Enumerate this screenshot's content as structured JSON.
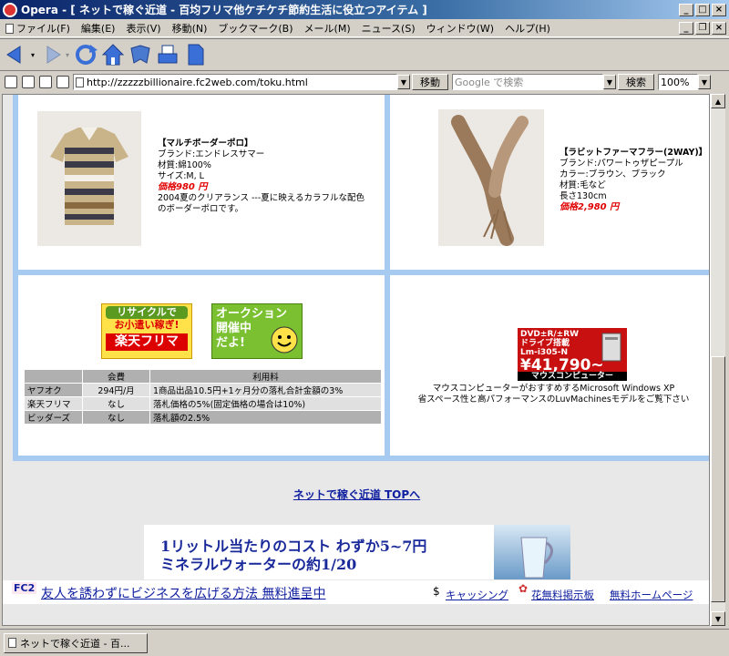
{
  "window": {
    "title": "Opera - [ ネットで稼ぐ近道 - 百均フリマ他ケチケチ節約生活に役立つアイテム ]",
    "minimize": "_",
    "maximize": "□",
    "close": "×"
  },
  "menu": {
    "items": [
      "ファイル(F)",
      "編集(E)",
      "表示(V)",
      "移動(N)",
      "ブックマーク(B)",
      "メール(M)",
      "ニュース(S)",
      "ウィンドウ(W)",
      "ヘルプ(H)"
    ]
  },
  "address": {
    "url": "http://zzzzzbillionaire.fc2web.com/toku.html",
    "go_label": "移動",
    "search_placeholder": "Google で検索",
    "search_label": "検索",
    "zoom": "100%"
  },
  "products": {
    "polo": {
      "name": "【マルチボーダーポロ】",
      "brand": "ブランド:エンドレスサマー",
      "material": "材質:綿100%",
      "size": "サイズ:M, L",
      "price": "価格980 円",
      "desc1": "2004夏のクリアランス ---夏に映えるカラフルな配色",
      "desc2": "のボーダーポロです。"
    },
    "muffler": {
      "name": "【ラビットファーマフラー(2WAY)】",
      "brand": "ブランド:パワートゥザピープル",
      "color": "カラー:ブラウン、ブラック",
      "material": "材質:毛など",
      "length": "長さ130cm",
      "price": "価格2,980 円"
    }
  },
  "banners": {
    "rakuten_line1": "リサイクルで",
    "rakuten_line2": "お小遣い稼ぎ!",
    "rakuten_line3": "楽天フリマ",
    "auction_line1": "オークション",
    "auction_line2": "開催中",
    "auction_line3": "だよ!"
  },
  "fee_table": {
    "headers": [
      "",
      "会費",
      "利用料"
    ],
    "rows": [
      [
        "ヤフオク",
        "294円/月",
        "1商品出品10.5円+1ヶ月分の落札合計金額の3%"
      ],
      [
        "楽天フリマ",
        "なし",
        "落札価格の5%(固定価格の場合は10%)"
      ],
      [
        "ビッダーズ",
        "なし",
        "落札額の2.5%"
      ]
    ]
  },
  "pc_ad": {
    "line1": "DVD±R/±RW",
    "line2": "ドライブ搭載",
    "line3": "Lm-i305-N",
    "price": "¥41,790~",
    "brand": "マウスコンピューター",
    "desc1": "マウスコンピューターがおすすめするMicrosoft Windows XP",
    "desc2": "省スペース性と高パフォーマンスのLuvMachinesモデルをご覧下さい"
  },
  "top_link": "ネットで稼ぐ近道 TOPへ",
  "water_ad": {
    "line1": "1リットル当たりのコスト わずか5~7円",
    "line2": "ミネラルウォーターの約1/20"
  },
  "footer": {
    "fc2": "FC2",
    "main_link": "友人を誘わずにビジネスを広げる方法 無料進呈中",
    "cashing": "キャッシング",
    "flower": "花無料掲示板",
    "homepage": "無料ホームページ"
  },
  "status": {
    "tab_title": "ネットで稼ぐ近道 - 百..."
  }
}
